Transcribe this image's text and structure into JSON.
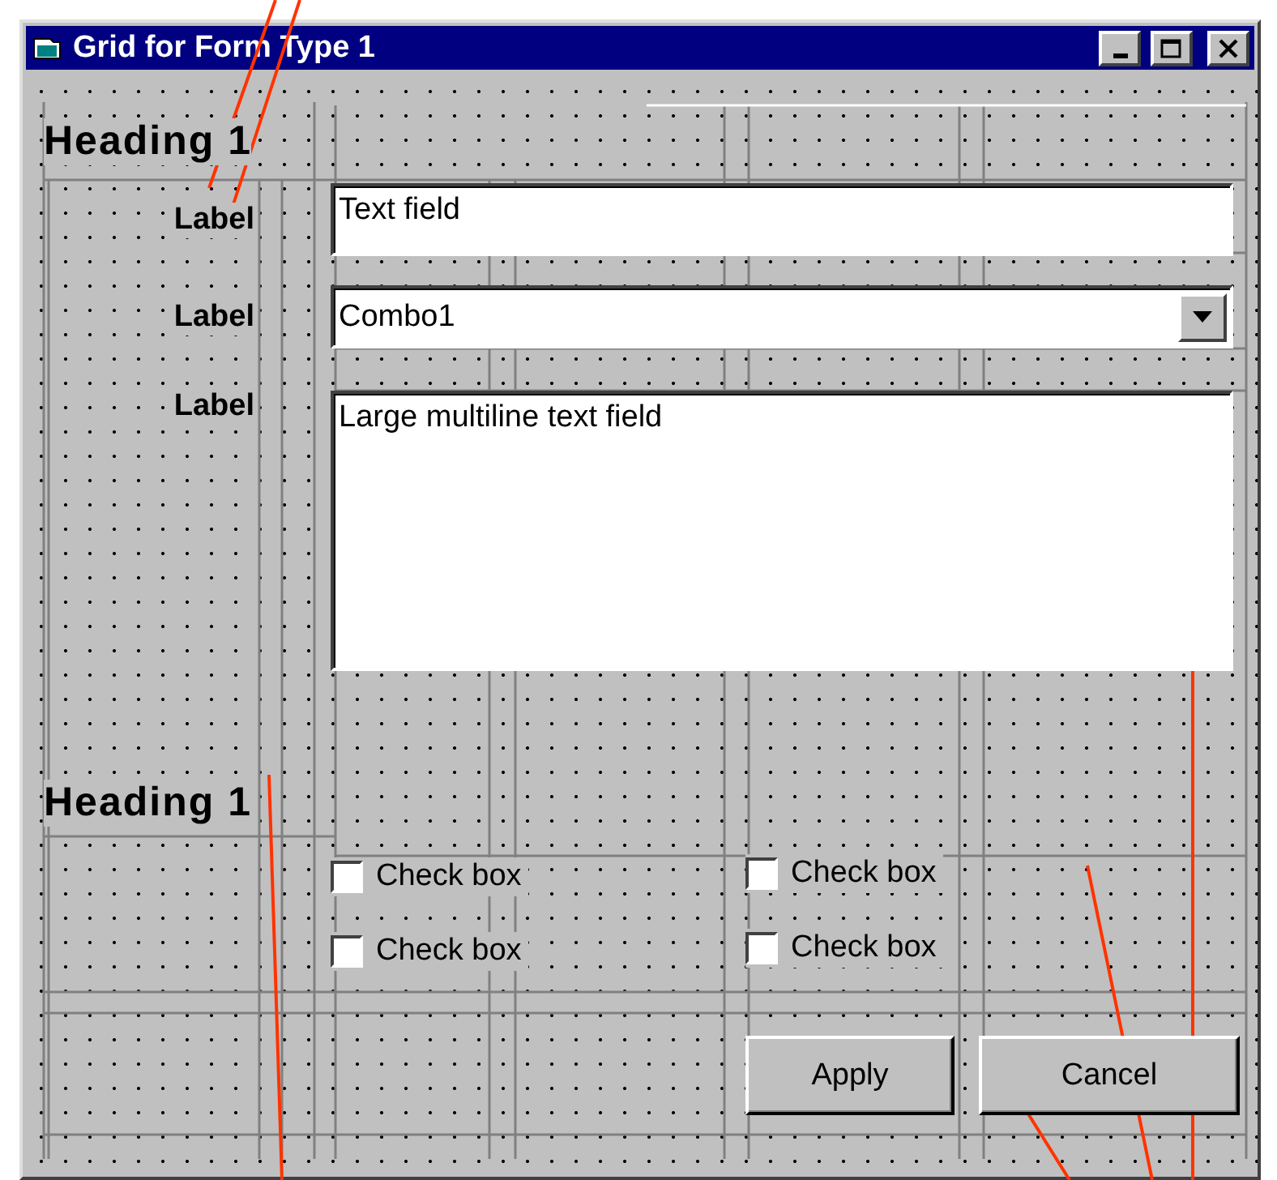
{
  "window": {
    "title": "Grid for Form Type 1"
  },
  "headings": [
    "Heading 1",
    "Heading 1"
  ],
  "labels": [
    "Label",
    "Label",
    "Label"
  ],
  "text_field": {
    "value": "Text field"
  },
  "combo": {
    "value": "Combo1"
  },
  "multiline_field": {
    "value": "Large multiline text field"
  },
  "checkboxes": [
    {
      "label": "Check box",
      "checked": false
    },
    {
      "label": "Check box",
      "checked": false
    },
    {
      "label": "Check box",
      "checked": false
    },
    {
      "label": "Check box",
      "checked": false
    }
  ],
  "buttons": [
    "Apply",
    "Cancel"
  ]
}
